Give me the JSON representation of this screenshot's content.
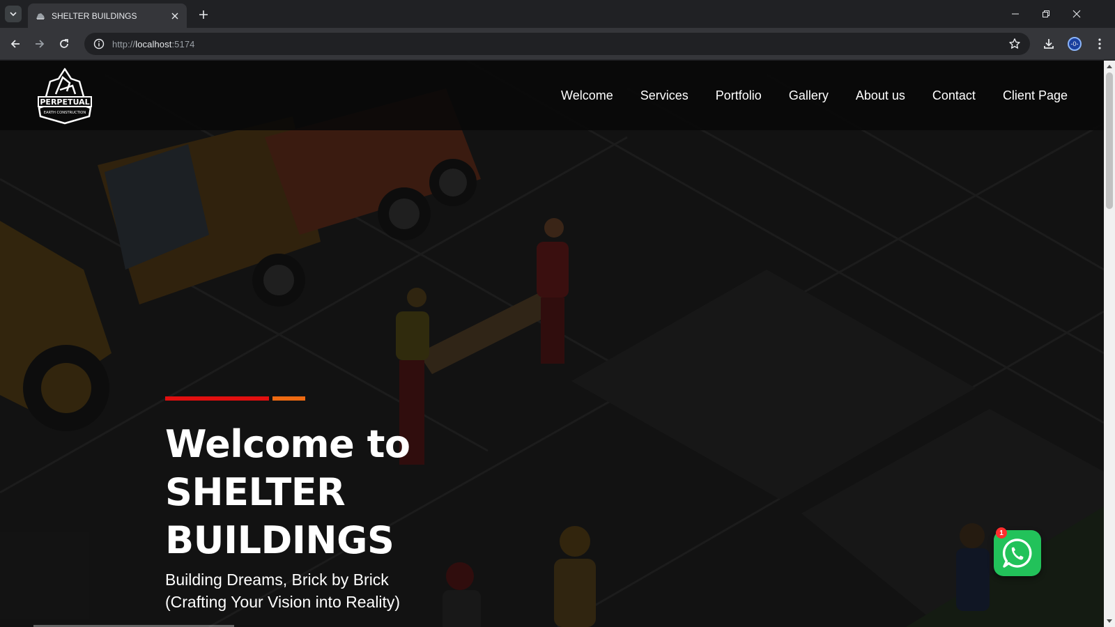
{
  "browser": {
    "tab_title": "SHELTER BUILDINGS",
    "url_scheme": "http://",
    "url_host": "localhost",
    "url_port": ":5174",
    "profile_label": "-0-"
  },
  "site": {
    "logo": {
      "title": "PERPETUAL",
      "subtitle": "EARTH CONSTRUCTION"
    },
    "nav": [
      "Welcome",
      "Services",
      "Portfolio",
      "Gallery",
      "About us",
      "Contact",
      "Client Page"
    ]
  },
  "hero": {
    "title_lines": [
      "Welcome to",
      "SHELTER",
      "BUILDINGS"
    ],
    "subtitle_lines": [
      "Building Dreams, Brick by Brick",
      "(Crafting Your Vision into Reality)"
    ],
    "accent_colors": [
      "#e10f0f",
      "#ee6a12"
    ]
  },
  "whatsapp": {
    "badge_count": "1",
    "color": "#22c25a"
  }
}
